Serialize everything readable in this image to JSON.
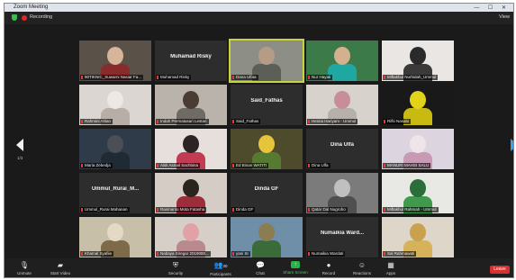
{
  "window": {
    "title": "Zoom Meeting",
    "controls": "— ☐ ✕"
  },
  "topbar": {
    "recording_label": "Recording",
    "view_label": "View"
  },
  "colors": {
    "accent": "#2d8cff",
    "active_speaker": "#c7d53a",
    "share": "#2ab24a",
    "leave": "#d7302f"
  },
  "pagination": {
    "prev_label": "1/3",
    "next_label": "1/3"
  },
  "tiles": [
    {
      "label": "90TIKNIC_Suwarni Nasiar Fa...",
      "center_name": ""
    },
    {
      "label": "Muhamad Risky",
      "center_name": "Muhamad Risky"
    },
    {
      "label": "Dana Ulfaa",
      "center_name": ""
    },
    {
      "label": "Nur Hayati",
      "center_name": ""
    },
    {
      "label": "Miftakhul Nurhidah_Ummul",
      "center_name": ""
    },
    {
      "label": "Rahmini Ahlan",
      "center_name": ""
    },
    {
      "label": "Indah Permatasari Lestari",
      "center_name": ""
    },
    {
      "label": "Said_Fathas",
      "center_name": "Said_Fathas"
    },
    {
      "label": "Hesna Hariyam - Ummul",
      "center_name": ""
    },
    {
      "label": "Rifki Nasabi",
      "center_name": ""
    },
    {
      "label": "Maria Zebedja",
      "center_name": ""
    },
    {
      "label": "Aisk Asmal Sachbina",
      "center_name": ""
    },
    {
      "label": "Ed Binan WATITI",
      "center_name": ""
    },
    {
      "label": "Dina Ulfa",
      "center_name": "Dina Ulfa"
    },
    {
      "label": "MANURI MAHSI SALU",
      "center_name": ""
    },
    {
      "label": "Ummul_Rurai Mahanan",
      "center_name": "Ummul_Rurai_M..."
    },
    {
      "label": "Rasmanto Mota Fatasha",
      "center_name": ""
    },
    {
      "label": "Dinda GF",
      "center_name": "Dinda GF"
    },
    {
      "label": "Qatar Dal Nugroho",
      "center_name": ""
    },
    {
      "label": "Miftakhul Rahmah - Ummul",
      "center_name": ""
    },
    {
      "label": "Khamal Syafiie",
      "center_name": ""
    },
    {
      "label": "Nabaya Siregar 2019080...",
      "center_name": ""
    },
    {
      "label": "yani Sr",
      "center_name": ""
    },
    {
      "label": "Numaikia Wardati",
      "center_name": "Numaikia Ward..."
    },
    {
      "label": "Sal Rahmawati",
      "center_name": ""
    }
  ],
  "toolbar": {
    "unmute": "Unmute",
    "start_video": "Start Video",
    "security": "Security",
    "participants": "Participants",
    "participants_count": "30",
    "chat": "Chat",
    "share_screen": "Share Screen",
    "record": "Record",
    "reactions": "Reactions",
    "apps": "Apps",
    "leave": "Leave"
  }
}
